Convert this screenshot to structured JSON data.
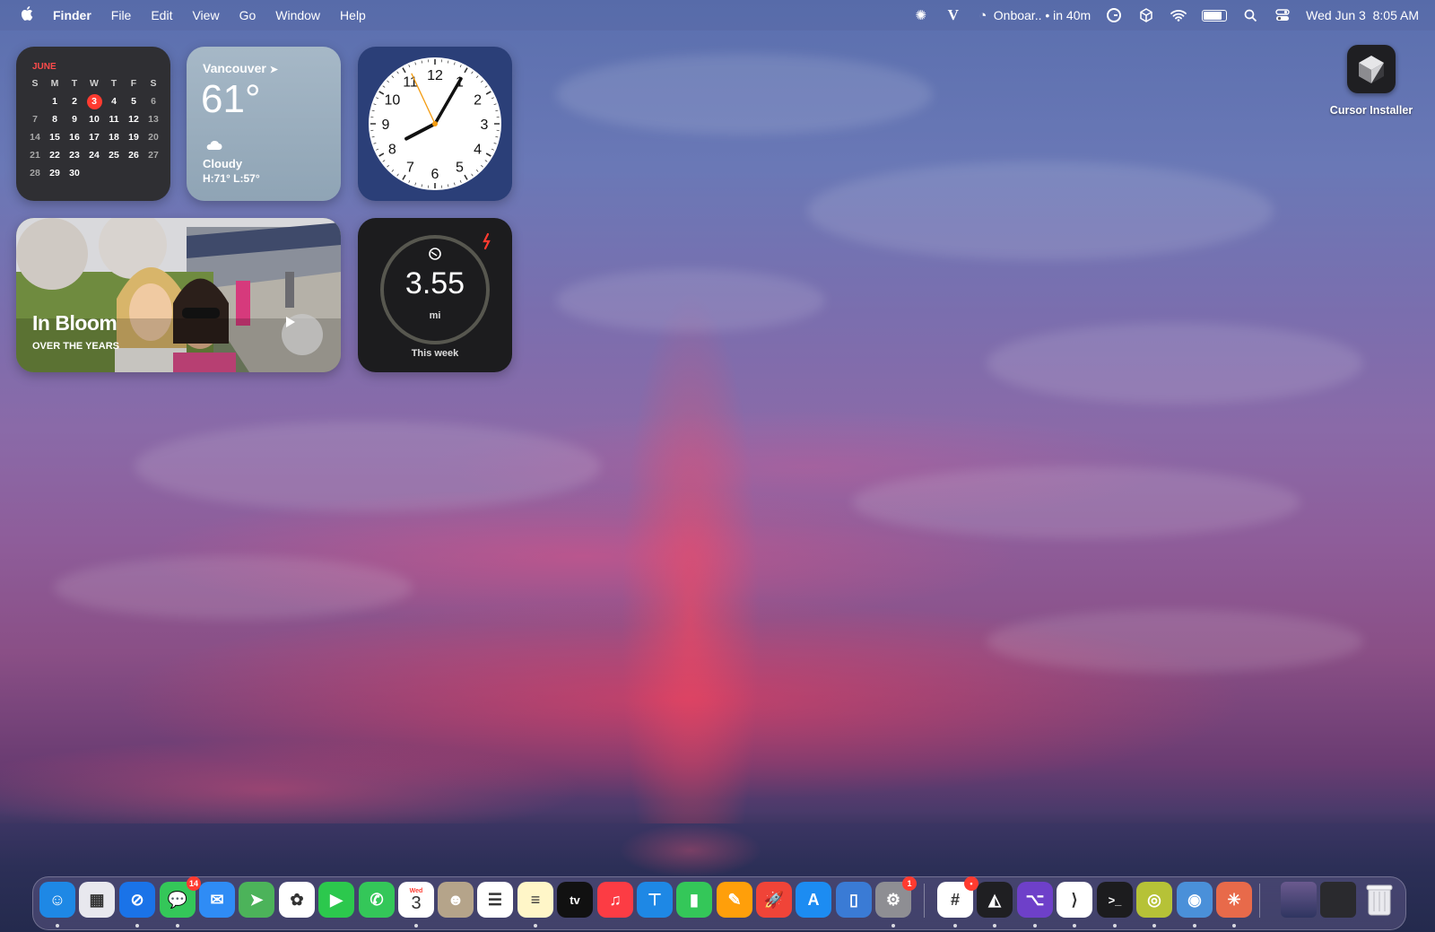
{
  "menubar": {
    "app_name": "Finder",
    "menus": [
      "File",
      "Edit",
      "View",
      "Go",
      "Window",
      "Help"
    ],
    "status": {
      "event": "Onboar.. • in 40m",
      "datetime": "Wed Jun 3  8:05 AM"
    }
  },
  "calendar_widget": {
    "month": "JUNE",
    "weekdays": [
      "S",
      "M",
      "T",
      "W",
      "T",
      "F",
      "S"
    ],
    "days": [
      "",
      "1",
      "2",
      "3",
      "4",
      "5",
      "6",
      "7",
      "8",
      "9",
      "10",
      "11",
      "12",
      "13",
      "14",
      "15",
      "16",
      "17",
      "18",
      "19",
      "20",
      "21",
      "22",
      "23",
      "24",
      "25",
      "26",
      "27",
      "28",
      "29",
      "30",
      "",
      "",
      "",
      ""
    ],
    "today": "3"
  },
  "weather_widget": {
    "city": "Vancouver",
    "temperature": "61°",
    "condition": "Cloudy",
    "high_low": "H:71° L:57°"
  },
  "clock_widget": {
    "numerals": [
      "12",
      "1",
      "2",
      "3",
      "4",
      "5",
      "6",
      "7",
      "8",
      "9",
      "10",
      "11"
    ],
    "time": "8:05"
  },
  "photos_widget": {
    "title": "In Bloom",
    "subtitle": "OVER THE YEARS"
  },
  "fitness_widget": {
    "value": "3.55",
    "unit": "mi",
    "caption": "This week"
  },
  "desktop": {
    "icons": [
      {
        "label": "Cursor Installer",
        "icon": "cursor-cube-icon"
      }
    ]
  },
  "dock": {
    "apps": [
      {
        "name": "Finder",
        "icon": "finder-icon",
        "color": "#1e88e5",
        "glyph": "☺",
        "running": true
      },
      {
        "name": "Launchpad",
        "icon": "launchpad-icon",
        "color": "#e8e8ee",
        "glyph": "▦",
        "running": false
      },
      {
        "name": "Safari",
        "icon": "safari-icon",
        "color": "#1a73e8",
        "glyph": "⊘",
        "running": true
      },
      {
        "name": "Messages",
        "icon": "messages-icon",
        "color": "#34c759",
        "glyph": "💬",
        "running": true,
        "badge": "14"
      },
      {
        "name": "Mail",
        "icon": "mail-icon",
        "color": "#2f8cf5",
        "glyph": "✉",
        "running": false
      },
      {
        "name": "Maps",
        "icon": "maps-icon",
        "color": "#4cb35a",
        "glyph": "➤",
        "running": false
      },
      {
        "name": "Photos",
        "icon": "photos-icon",
        "color": "#ffffff",
        "glyph": "✿",
        "running": false
      },
      {
        "name": "FaceTime",
        "icon": "facetime-icon",
        "color": "#2cc84d",
        "glyph": "▶",
        "running": false
      },
      {
        "name": "Phone",
        "icon": "phone-icon",
        "color": "#34c759",
        "glyph": "✆",
        "running": false
      },
      {
        "name": "Calendar",
        "icon": "calendar-icon",
        "color": "#ffffff",
        "glyph": "3",
        "running": true,
        "label_top": "Wed"
      },
      {
        "name": "Contacts",
        "icon": "contacts-icon",
        "color": "#b5a48a",
        "glyph": "☻",
        "running": false
      },
      {
        "name": "Reminders",
        "icon": "reminders-icon",
        "color": "#ffffff",
        "glyph": "☰",
        "running": false
      },
      {
        "name": "Notes",
        "icon": "notes-icon",
        "color": "#fff6c8",
        "glyph": "≡",
        "running": true
      },
      {
        "name": "TV",
        "icon": "tv-icon",
        "color": "#111111",
        "glyph": "tv",
        "running": false
      },
      {
        "name": "Music",
        "icon": "music-icon",
        "color": "#fc3c44",
        "glyph": "♫",
        "running": false
      },
      {
        "name": "Keynote",
        "icon": "keynote-icon",
        "color": "#1e88e5",
        "glyph": "⊤",
        "running": false
      },
      {
        "name": "Numbers",
        "icon": "numbers-icon",
        "color": "#34c759",
        "glyph": "▮",
        "running": false
      },
      {
        "name": "Pages",
        "icon": "pages-icon",
        "color": "#ff9f0a",
        "glyph": "✎",
        "running": false
      },
      {
        "name": "Rocket",
        "icon": "rocket-icon",
        "color": "#f04438",
        "glyph": "🚀",
        "running": false
      },
      {
        "name": "App Store",
        "icon": "app-store-icon",
        "color": "#1c8cf2",
        "glyph": "A",
        "running": false
      },
      {
        "name": "iPhone Mirroring",
        "icon": "iphone-mirroring-icon",
        "color": "#3a7bd5",
        "glyph": "▯",
        "running": false
      },
      {
        "name": "System Settings",
        "icon": "settings-icon",
        "color": "#8e8e93",
        "glyph": "⚙",
        "running": true,
        "badge": "1"
      },
      {
        "name": "Slack",
        "icon": "slack-icon",
        "color": "#ffffff",
        "glyph": "#",
        "running": true,
        "badge": "•"
      },
      {
        "name": "Cursor",
        "icon": "cursor-icon",
        "color": "#1f1f22",
        "glyph": "◭",
        "running": true
      },
      {
        "name": "GitHub Desktop",
        "icon": "github-icon",
        "color": "#6e40c9",
        "glyph": "⌥",
        "running": true
      },
      {
        "name": "VS Code",
        "icon": "vscode-icon",
        "color": "#ffffff",
        "glyph": "⟩",
        "running": true
      },
      {
        "name": "Terminal",
        "icon": "terminal-icon",
        "color": "#1c1c1e",
        "glyph": ">_",
        "running": true
      },
      {
        "name": "Spiral",
        "icon": "spiral-icon",
        "color": "#b6c237",
        "glyph": "◎",
        "running": true
      },
      {
        "name": "Finder Disk",
        "icon": "disk-utility-icon",
        "color": "#4a90d9",
        "glyph": "◉",
        "running": true
      },
      {
        "name": "Claude",
        "icon": "claude-icon",
        "color": "#e86a4a",
        "glyph": "✳",
        "running": true
      }
    ],
    "stacks": [
      {
        "name": "Recent Folder",
        "icon": "folder-stack-icon"
      },
      {
        "name": "Downloads Stack",
        "icon": "downloads-stack-icon"
      }
    ],
    "trash": {
      "name": "Trash",
      "icon": "trash-icon"
    }
  }
}
